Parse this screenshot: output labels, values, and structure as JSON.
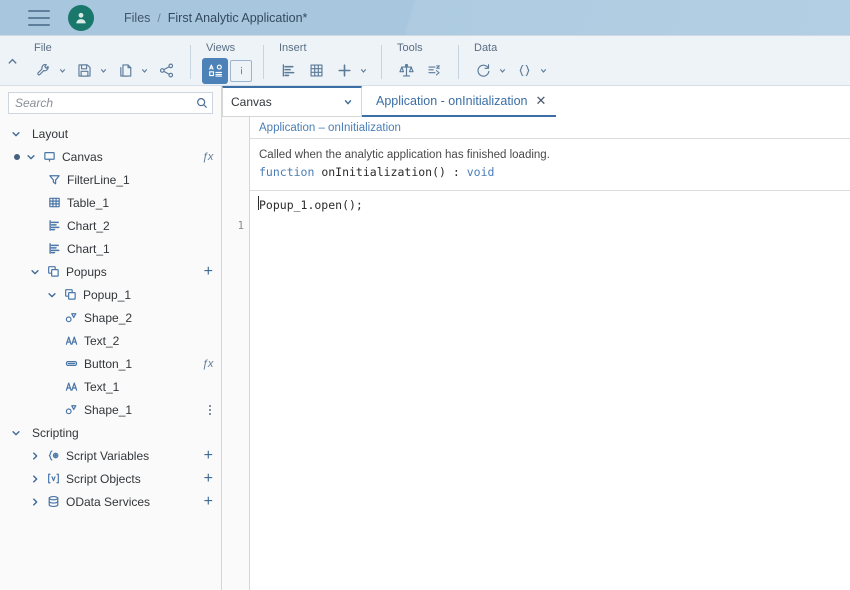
{
  "header": {
    "menu_icon": "hamburger-menu-icon",
    "avatar_icon": "user-avatar-icon",
    "breadcrumb_root": "Files",
    "breadcrumb_separator": "/",
    "breadcrumb_current": "First Analytic Application*",
    "bg_color": "#a8c6de",
    "avatar_color": "#19776c"
  },
  "ribbon": {
    "collapse_icon": "chevron-up-icon",
    "groups": [
      {
        "title": "File",
        "items": [
          {
            "icon": "wrench-icon",
            "caret": true
          },
          {
            "icon": "save-floppy-icon",
            "caret": true
          },
          {
            "icon": "copy-pages-icon",
            "caret": true
          },
          {
            "icon": "share-icon",
            "caret": false
          }
        ]
      },
      {
        "title": "Views",
        "items": [
          {
            "icon": "outline-view-icon",
            "caret": false,
            "selected": true
          },
          {
            "icon": "info-panel-icon",
            "caret": false,
            "boxed": true
          }
        ]
      },
      {
        "title": "Insert",
        "items": [
          {
            "icon": "chart-bar-icon",
            "caret": false
          },
          {
            "icon": "table-grid-icon",
            "caret": false
          },
          {
            "icon": "plus-icon",
            "caret": true
          }
        ]
      },
      {
        "title": "Tools",
        "items": [
          {
            "icon": "scales-balance-icon",
            "caret": false
          },
          {
            "icon": "script-lines-icon",
            "caret": false
          }
        ]
      },
      {
        "title": "Data",
        "items": [
          {
            "icon": "refresh-icon",
            "caret": true
          },
          {
            "icon": "braces-icon",
            "caret": true
          }
        ]
      }
    ]
  },
  "sidebar": {
    "search": {
      "value": "",
      "placeholder": "Search",
      "icon": "search-icon"
    },
    "tree": [
      {
        "label": "Layout",
        "kind": "group",
        "indent": 0,
        "expanded": true,
        "toggle": true
      },
      {
        "label": "Canvas",
        "kind": "node",
        "indent": 0,
        "icon": "canvas-screen-icon",
        "expanded": true,
        "toggle": true,
        "dot": true,
        "right": "fx"
      },
      {
        "label": "FilterLine_1",
        "kind": "leaf",
        "indent": 2,
        "icon": "filter-funnel-icon"
      },
      {
        "label": "Table_1",
        "kind": "leaf",
        "indent": 2,
        "icon": "table-grid-icon"
      },
      {
        "label": "Chart_2",
        "kind": "leaf",
        "indent": 2,
        "icon": "chart-bar-icon"
      },
      {
        "label": "Chart_1",
        "kind": "leaf",
        "indent": 2,
        "icon": "chart-bar-icon"
      },
      {
        "label": "Popups",
        "kind": "node",
        "indent": 1,
        "icon": "popup-layers-icon",
        "expanded": true,
        "toggle": true,
        "right": "plus"
      },
      {
        "label": "Popup_1",
        "kind": "node",
        "indent": 2,
        "icon": "popup-layers-icon",
        "expanded": true,
        "toggle": true
      },
      {
        "label": "Shape_2",
        "kind": "leaf",
        "indent": 3,
        "icon": "shape-icon"
      },
      {
        "label": "Text_2",
        "kind": "leaf",
        "indent": 3,
        "icon": "text-aa-icon"
      },
      {
        "label": "Button_1",
        "kind": "leaf",
        "indent": 3,
        "icon": "button-icon",
        "right": "fx"
      },
      {
        "label": "Text_1",
        "kind": "leaf",
        "indent": 3,
        "icon": "text-aa-icon"
      },
      {
        "label": "Shape_1",
        "kind": "leaf",
        "indent": 3,
        "icon": "shape-icon",
        "right": "kebab"
      },
      {
        "label": "Scripting",
        "kind": "group",
        "indent": 0,
        "expanded": true,
        "toggle": true
      },
      {
        "label": "Script Variables",
        "kind": "node",
        "indent": 1,
        "icon": "script-variable-icon",
        "expanded": false,
        "toggle": true,
        "right": "plus"
      },
      {
        "label": "Script Objects",
        "kind": "node",
        "indent": 1,
        "icon": "script-object-icon",
        "expanded": false,
        "toggle": true,
        "right": "plus"
      },
      {
        "label": "OData Services",
        "kind": "node",
        "indent": 1,
        "icon": "database-icon",
        "expanded": false,
        "toggle": true,
        "right": "plus"
      }
    ]
  },
  "editor": {
    "canvas_select": {
      "label": "Canvas",
      "icon": "chevron-down-icon"
    },
    "tab": {
      "label": "Application - onInitialization",
      "close_icon": "close-icon"
    },
    "signature_title": "Application – onInitialization",
    "doc_text": "Called when the analytic application has finished loading.",
    "signature_keyword_1": "function",
    "signature_name": " onInitialization() : ",
    "signature_keyword_2": "void",
    "line_number": "1",
    "code_line": "Popup_1.open();",
    "accent_color": "#3a6ea5"
  }
}
